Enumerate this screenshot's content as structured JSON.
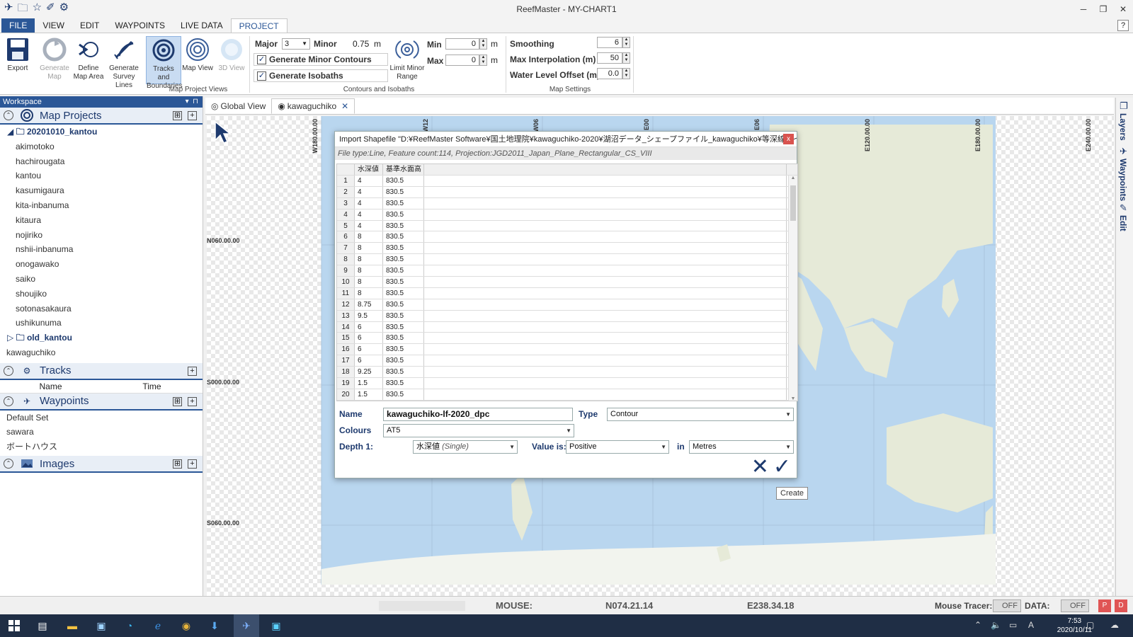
{
  "window": {
    "title": "ReefMaster - MY-CHART1",
    "minimize": "─",
    "restore": "❐",
    "close": "✕"
  },
  "menu": {
    "file": "FILE",
    "view": "VIEW",
    "edit": "EDIT",
    "waypoints": "WAYPOINTS",
    "live_data": "LIVE DATA",
    "project": "PROJECT",
    "help": "?"
  },
  "ribbon": {
    "export": "Export",
    "generate_map": "Generate Map",
    "define_map_area": "Define Map Area",
    "generate_survey_lines": "Generate Survey Lines",
    "tracks_and_boundaries": "Tracks and Boundaries",
    "map_view": "Map View",
    "view_3d": "3D View",
    "group_map_project_views": "Map Project Views",
    "major_label": "Major",
    "major_value": "3",
    "minor_label": "Minor",
    "minor_value": "0.75",
    "unit_m": "m",
    "generate_minor_contours": "Generate Minor Contours",
    "generate_isobaths": "Generate Isobaths",
    "limit_minor_range": "Limit Minor Range",
    "min_label": "Min",
    "min_value": "0",
    "max_label": "Max",
    "max_value": "0",
    "group_contours_isobaths": "Contours and Isobaths",
    "smoothing_label": "Smoothing",
    "smoothing_value": "6",
    "max_interp_label": "Max Interpolation (m)",
    "max_interp_value": "50",
    "water_level_label": "Water Level Offset (m)",
    "water_level_value": "0.0",
    "group_map_settings": "Map Settings"
  },
  "workspace": {
    "title": "Workspace",
    "map_projects_title": "Map Projects",
    "folder_open": "20201010_kantou",
    "projects": [
      "akimotoko",
      "hachirougata",
      "kantou",
      "kasumigaura",
      "kita-inbanuma",
      "kitaura",
      "nojiriko",
      "nshii-inbanuma",
      "onogawako",
      "saiko",
      "shoujiko",
      "sotonasakaura",
      "ushikunuma"
    ],
    "folder_closed": "old_kantou",
    "root_project": "kawaguchiko",
    "tracks_title": "Tracks",
    "tracks_col_name": "Name",
    "tracks_col_time": "Time",
    "waypoints_title": "Waypoints",
    "waypoint_items": [
      "Default Set",
      "sawara",
      "ボートハウス"
    ],
    "images_title": "Images"
  },
  "tabs": {
    "global_view": "Global View",
    "kawaguchiko": "kawaguchiko"
  },
  "map": {
    "lon_labels": [
      "W180.00.00",
      "W12",
      "W06",
      "E00",
      "E06",
      "E120.00.00",
      "E180.00.00",
      "E240.00.00"
    ],
    "lat_labels": [
      "N060.00.00",
      "S000.00.00",
      "S060.00.00"
    ],
    "ocean_color": "#b9d6ef",
    "land_color": "#e6ead8"
  },
  "dock": {
    "layers": "Layers",
    "waypoints": "Waypoints",
    "edit": "Edit"
  },
  "dialog": {
    "title": "Import Shapefile \"D:¥ReefMaster Software¥国土地理院¥kawaguchiko-2020¥湖沼データ_シェープファイル_kawaguchiko¥等深線ラインデータ¥kawaguc...",
    "close": "x",
    "info": "File type:Line, Feature count:114, Projection:JGD2011_Japan_Plane_Rectangular_CS_VIII",
    "col1": "水深値",
    "col2": "基準水面高",
    "rows": [
      [
        "1",
        "4",
        "830.5"
      ],
      [
        "2",
        "4",
        "830.5"
      ],
      [
        "3",
        "4",
        "830.5"
      ],
      [
        "4",
        "4",
        "830.5"
      ],
      [
        "5",
        "4",
        "830.5"
      ],
      [
        "6",
        "8",
        "830.5"
      ],
      [
        "7",
        "8",
        "830.5"
      ],
      [
        "8",
        "8",
        "830.5"
      ],
      [
        "9",
        "8",
        "830.5"
      ],
      [
        "10",
        "8",
        "830.5"
      ],
      [
        "11",
        "8",
        "830.5"
      ],
      [
        "12",
        "8.75",
        "830.5"
      ],
      [
        "13",
        "9.5",
        "830.5"
      ],
      [
        "14",
        "6",
        "830.5"
      ],
      [
        "15",
        "6",
        "830.5"
      ],
      [
        "16",
        "6",
        "830.5"
      ],
      [
        "17",
        "6",
        "830.5"
      ],
      [
        "18",
        "9.25",
        "830.5"
      ],
      [
        "19",
        "1.5",
        "830.5"
      ],
      [
        "20",
        "1.5",
        "830.5"
      ]
    ],
    "name_label": "Name",
    "name_value": "kawaguchiko-lf-2020_dpc",
    "type_label": "Type",
    "type_value": "Contour",
    "colours_label": "Colours",
    "colours_value": "AT5",
    "depth_label": "Depth 1:",
    "depth_value": "水深値",
    "depth_hint": "(Single)",
    "value_is_label": "Value is:",
    "value_is_value": "Positive",
    "in_label": "in",
    "units_value": "Metres",
    "cancel": "✕",
    "ok": "✓",
    "tooltip": "Create"
  },
  "status": {
    "mouse_label": "MOUSE:",
    "mouse_lat": "N074.21.14",
    "mouse_lon": "E238.34.18",
    "mouse_tracer_label": "Mouse Tracer:",
    "mouse_tracer_state": "OFF",
    "data_label": "DATA:",
    "data_state": "OFF",
    "p_label": "P",
    "d_label": "D"
  },
  "taskbar": {
    "time": "7:53",
    "date": "2020/10/11",
    "ime": "A"
  }
}
